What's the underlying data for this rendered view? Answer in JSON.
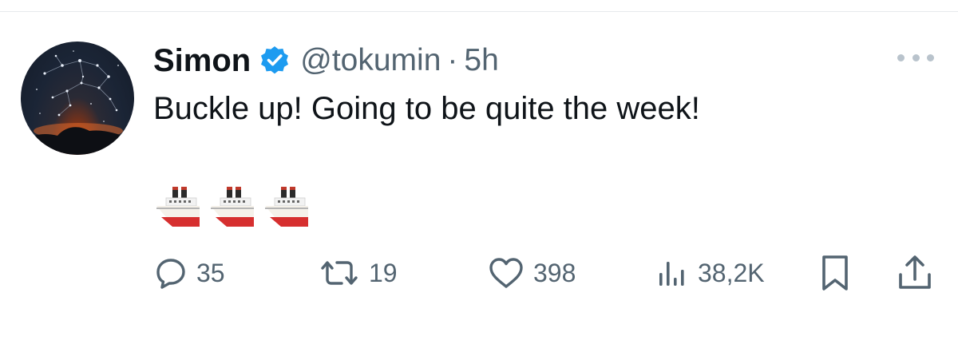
{
  "tweet": {
    "author": {
      "display_name": "Simon",
      "handle": "@tokumin",
      "verified": true,
      "avatar_icon": "night-sky-avatar"
    },
    "separator": "·",
    "time": "5h",
    "text": "Buckle up! Going to be quite the week!",
    "emoji": [
      "🚢",
      "🚢",
      "🚢"
    ],
    "emoji_icon": "ship-icon",
    "actions": {
      "reply_count": "35",
      "retweet_count": "19",
      "like_count": "398",
      "views_count": "38,2K"
    }
  },
  "colors": {
    "text_primary": "#0f1419",
    "text_secondary": "#536471",
    "verified_blue": "#1d9bf0",
    "divider": "#e6e9ec"
  }
}
